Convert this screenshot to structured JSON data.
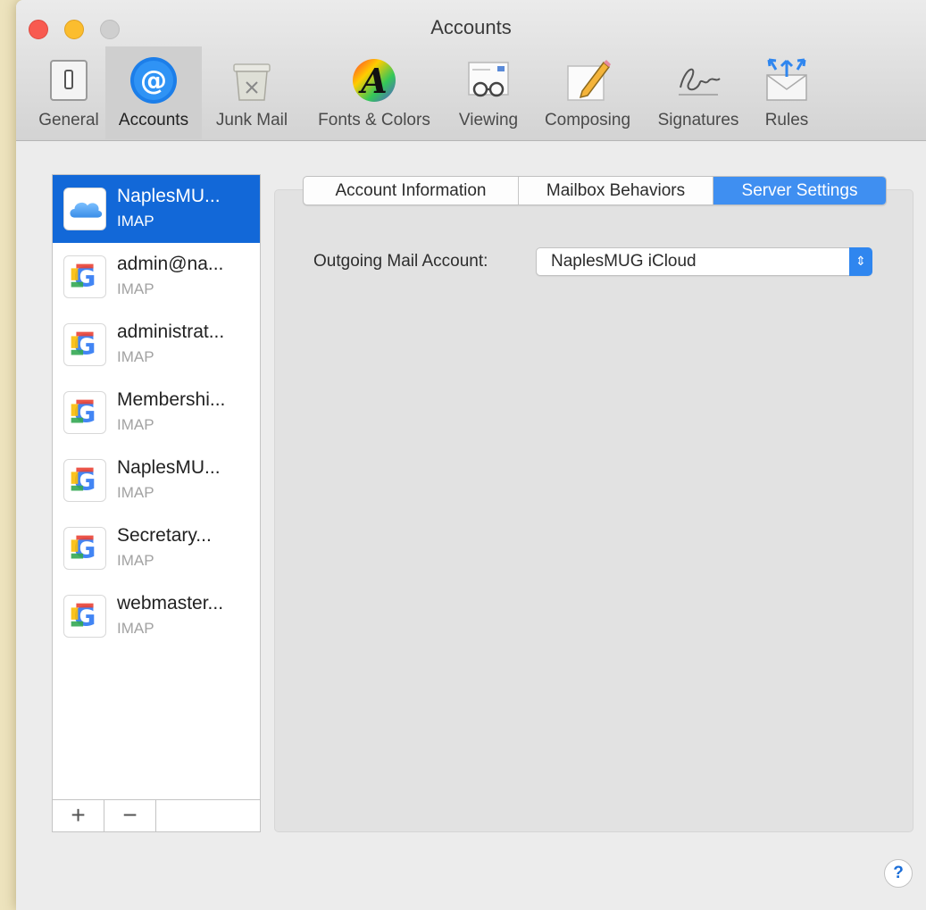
{
  "window": {
    "title": "Accounts"
  },
  "toolbar": {
    "items": [
      {
        "label": "General",
        "icon": "general-switch-icon"
      },
      {
        "label": "Accounts",
        "icon": "at-sign-icon"
      },
      {
        "label": "Junk Mail",
        "icon": "trash-bin-icon"
      },
      {
        "label": "Fonts & Colors",
        "icon": "font-colors-icon"
      },
      {
        "label": "Viewing",
        "icon": "glasses-icon"
      },
      {
        "label": "Composing",
        "icon": "pencil-paper-icon"
      },
      {
        "label": "Signatures",
        "icon": "signature-icon"
      },
      {
        "label": "Rules",
        "icon": "envelope-arrows-icon"
      }
    ]
  },
  "accounts": [
    {
      "name": "NaplesMU...",
      "type": "IMAP",
      "icon": "icloud-icon"
    },
    {
      "name": "admin@na...",
      "type": "IMAP",
      "icon": "google-icon"
    },
    {
      "name": "administrat...",
      "type": "IMAP",
      "icon": "google-icon"
    },
    {
      "name": "Membershi...",
      "type": "IMAP",
      "icon": "google-icon"
    },
    {
      "name": "NaplesMU...",
      "type": "IMAP",
      "icon": "google-icon"
    },
    {
      "name": "Secretary...",
      "type": "IMAP",
      "icon": "google-icon"
    },
    {
      "name": "webmaster...",
      "type": "IMAP",
      "icon": "google-icon"
    }
  ],
  "list_buttons": {
    "add": "+",
    "remove": "−"
  },
  "tabs": [
    {
      "label": "Account Information"
    },
    {
      "label": "Mailbox Behaviors"
    },
    {
      "label": "Server Settings"
    }
  ],
  "server_settings": {
    "outgoing_label": "Outgoing Mail Account:",
    "outgoing_value": "NaplesMUG iCloud"
  },
  "help": {
    "label": "?"
  },
  "colors": {
    "accent": "#1268d8",
    "tab_active": "#3f8ff1"
  }
}
